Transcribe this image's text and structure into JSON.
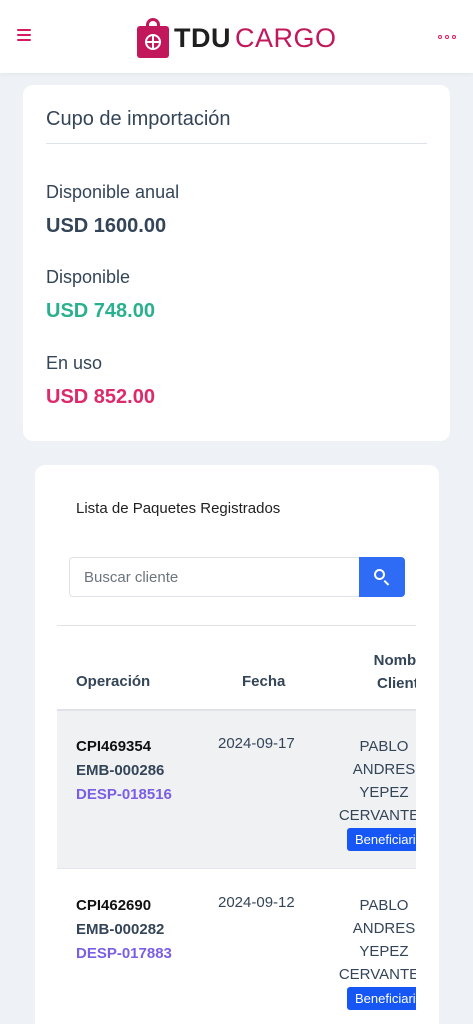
{
  "header": {
    "brand_part1": "TDU",
    "brand_part2": "CARGO",
    "menu_icon": "hamburger-menu-icon",
    "more_icon": "more-dots-icon",
    "accent": "#d81b60"
  },
  "quota": {
    "title": "Cupo de importación",
    "annual_label": "Disponible anual",
    "annual_value": "USD 1600.00",
    "available_label": "Disponible",
    "available_value": "USD 748.00",
    "inuse_label": "En uso",
    "inuse_value": "USD 852.00",
    "colors": {
      "available": "#2bb08f",
      "inuse": "#dc2a6a"
    }
  },
  "packages": {
    "title": "Lista de Paquetes Registrados",
    "search_placeholder": "Buscar cliente",
    "search_icon": "search-icon",
    "columns": [
      "Operación",
      "Fecha",
      "Nombre Cliente"
    ],
    "column_name_line1": "Nombre",
    "column_name_line2": "Cliente",
    "rows": [
      {
        "op1": "CPI469354",
        "op2": "EMB-000286",
        "op3": "DESP-018516",
        "date": "2024-09-17",
        "name1": "PABLO",
        "name2": "ANDRES",
        "name3": "YEPEZ",
        "name4": "CERVANTES",
        "badge": "Beneficiario"
      },
      {
        "op1": "CPI462690",
        "op2": "EMB-000282",
        "op3": "DESP-017883",
        "date": "2024-09-12",
        "name1": "PABLO",
        "name2": "ANDRES",
        "name3": "YEPEZ",
        "name4": "CERVANTES",
        "badge": "Beneficiario"
      }
    ]
  }
}
